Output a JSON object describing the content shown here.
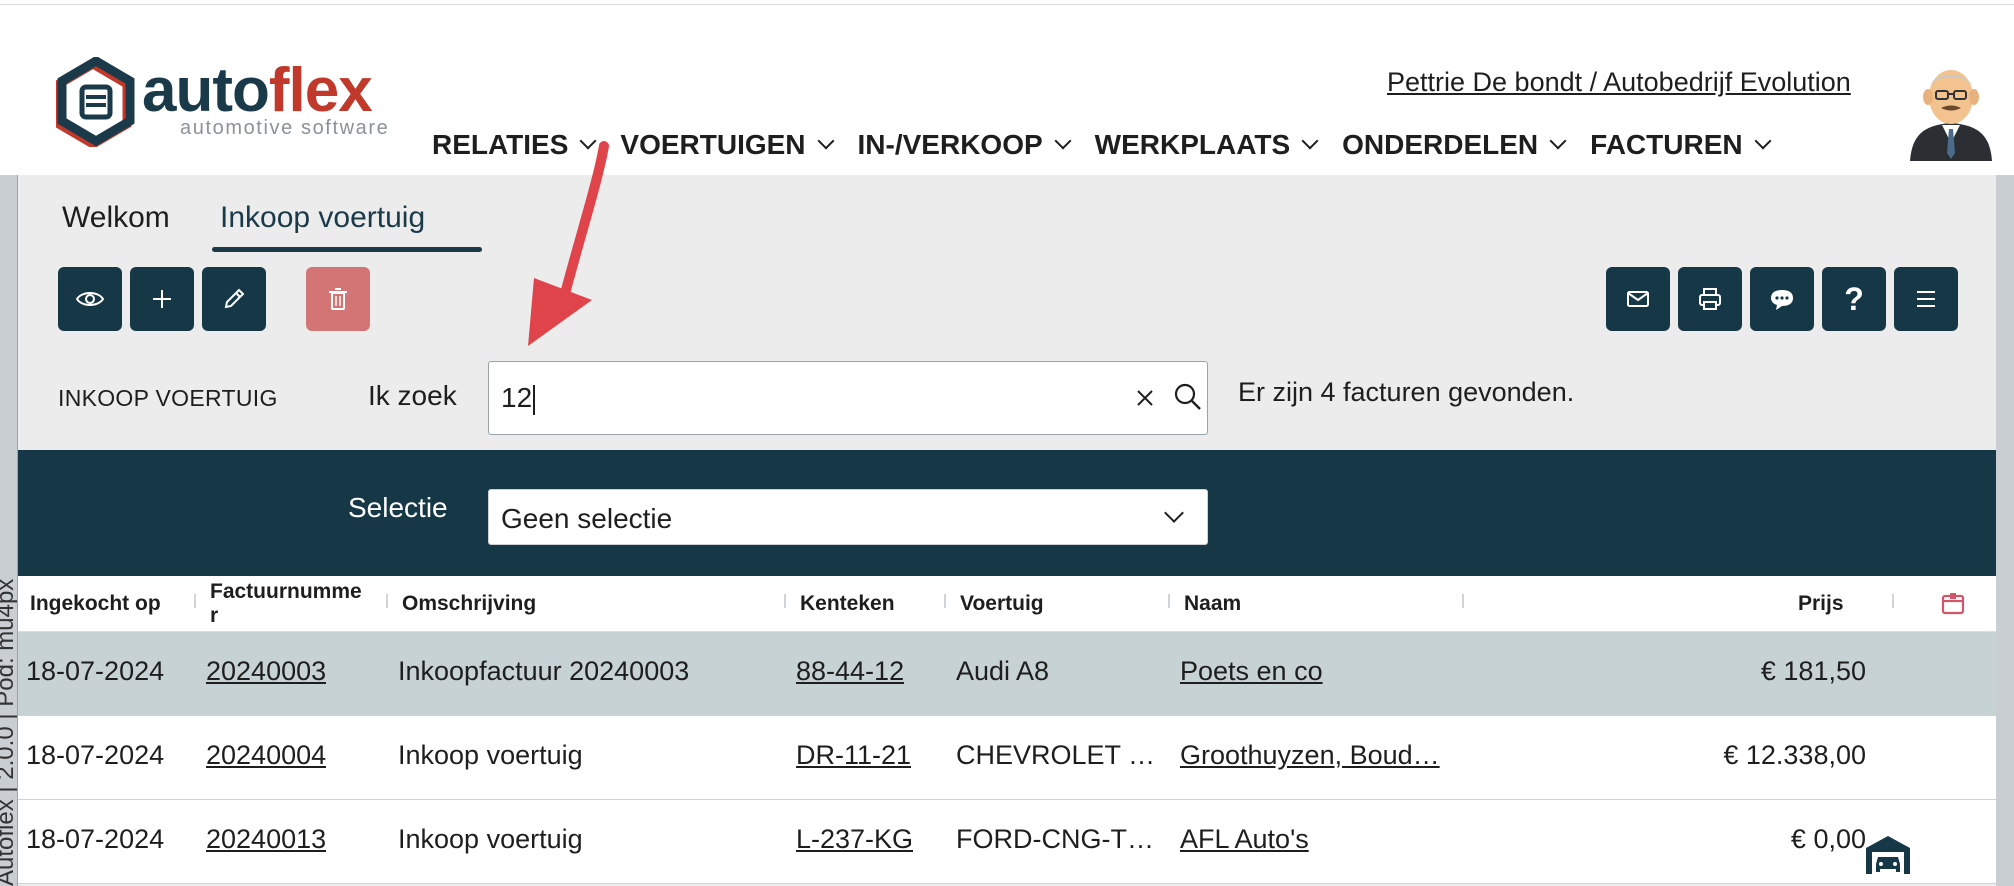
{
  "header": {
    "logo_main": "auto",
    "logo_accent": "flex",
    "logo_sub": "automotive software",
    "user": "Pettrie De bondt / Autobedrijf Evolution",
    "nav": [
      "RELATIES",
      "VOERTUIGEN",
      "IN-/VERKOOP",
      "WERKPLAATS",
      "ONDERDELEN",
      "FACTUREN"
    ]
  },
  "left_strip": "Autoflex | 2.0.0 | Pod: mu4px",
  "tabs": [
    "Welkom",
    "Inkoop voertuig"
  ],
  "toolbar": {
    "left": [
      "eye-icon",
      "plus-icon",
      "pencil-icon",
      "trash-icon"
    ],
    "right": [
      "mail-icon",
      "printer-icon",
      "chat-icon",
      "help-icon",
      "menu-icon"
    ],
    "help_glyph": "?"
  },
  "search": {
    "section": "INKOOP VOERTUIG",
    "label": "Ik zoek",
    "value": "12",
    "result": "Er zijn 4 facturen gevonden."
  },
  "selection": {
    "label": "Selectie",
    "value": "Geen selectie"
  },
  "table": {
    "columns": [
      "Ingekocht op",
      "Factuurnummer",
      "Omschrijving",
      "Kenteken",
      "Voertuig",
      "Naam",
      "Prijs"
    ],
    "col_factuur_a": "Factuurnumme",
    "col_factuur_b": "r",
    "rows": [
      {
        "date": "18-07-2024",
        "invoice": "20240003",
        "desc": "Inkoopfactuur 20240003",
        "plate": "88-44-12",
        "vehicle": "Audi A8",
        "name": "Poets en co",
        "price": "€ 181,50"
      },
      {
        "date": "18-07-2024",
        "invoice": "20240004",
        "desc": "Inkoop voertuig",
        "plate": "DR-11-21",
        "vehicle": "CHEVROLET …",
        "name": "Groothuyzen, Boud…",
        "price": "€ 12.338,00"
      },
      {
        "date": "18-07-2024",
        "invoice": "20240013",
        "desc": "Inkoop voertuig",
        "plate": "L-237-KG",
        "vehicle": "FORD-CNG-T…",
        "name": "AFL Auto's",
        "price": "€ 0,00"
      }
    ]
  },
  "colors": {
    "primary": "#163746",
    "accent": "#c0392b",
    "delete": "#d47575",
    "selected_row": "#c7d2d5",
    "annotation_arrow": "#e0444b"
  }
}
